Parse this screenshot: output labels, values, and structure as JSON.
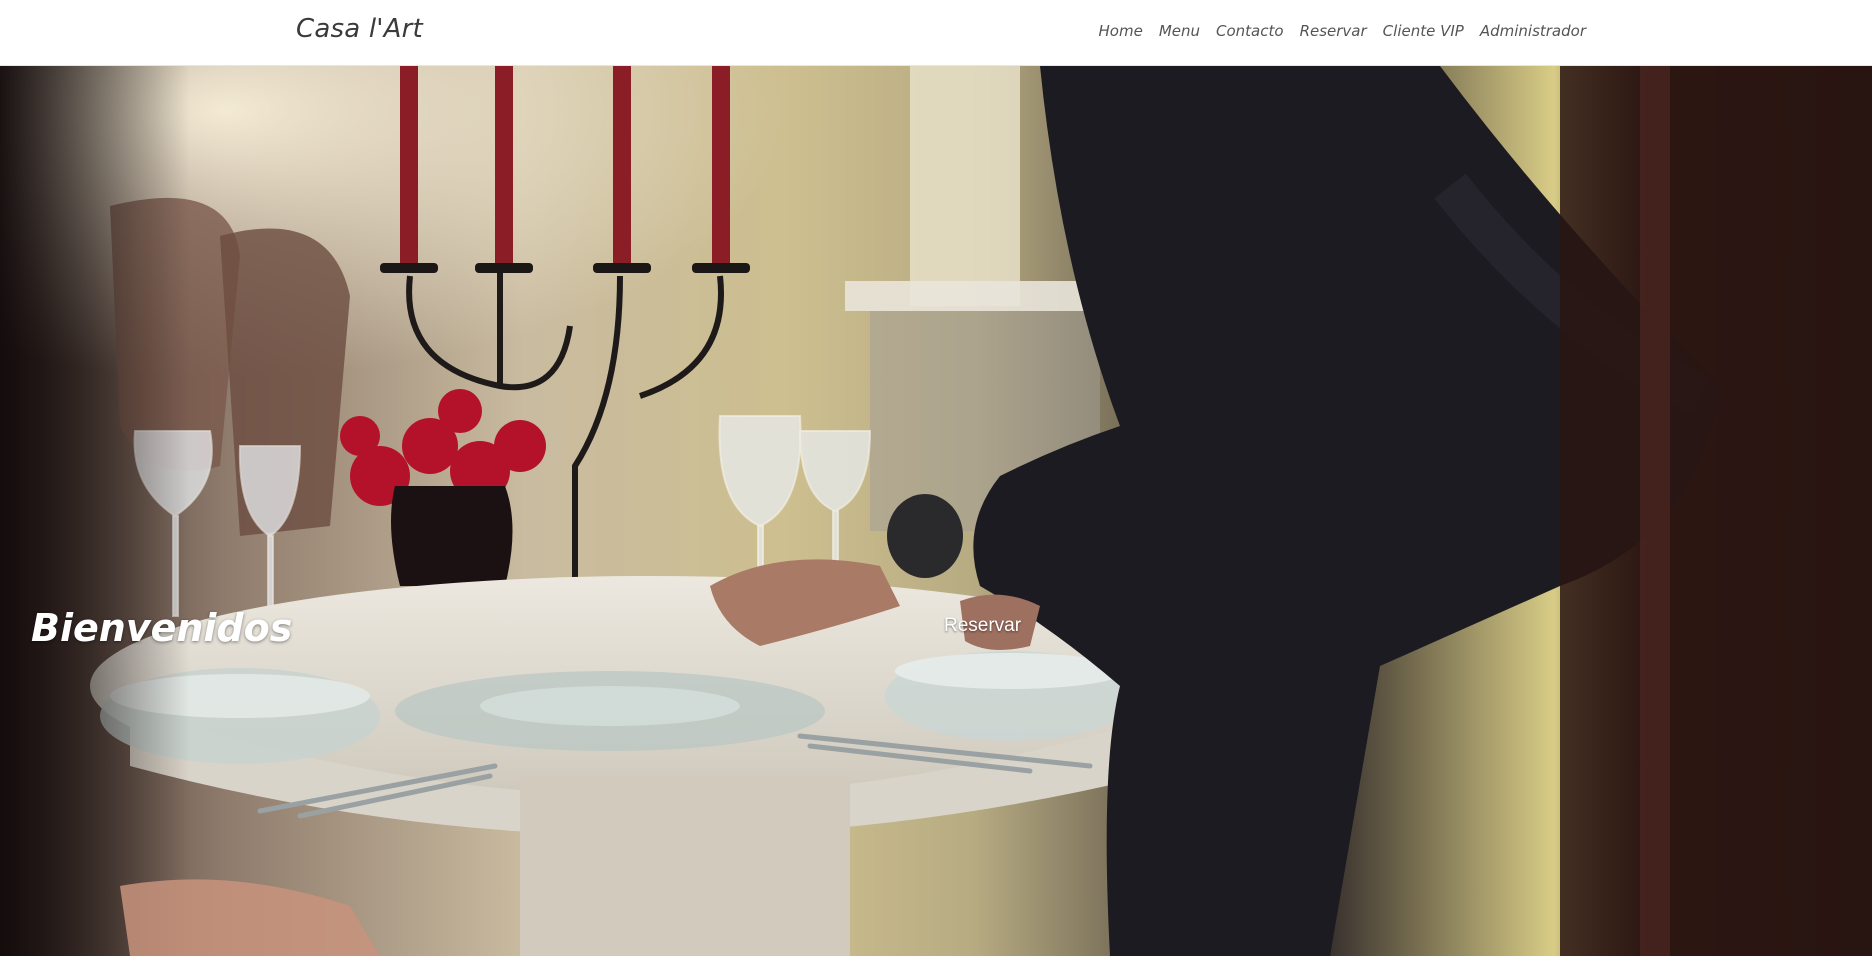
{
  "brand": "Casa l'Art",
  "nav": {
    "items": [
      "Home",
      "Menu",
      "Contacto",
      "Reservar",
      "Cliente VIP",
      "Administrador"
    ]
  },
  "hero": {
    "headline": "Bienvenidos",
    "cta_label": "Reservar",
    "image_semantic": "restaurant-table-scene-image"
  },
  "colors": {
    "header_bg": "#ffffff",
    "nav_text": "#555555",
    "hero_text": "#ffffff"
  }
}
